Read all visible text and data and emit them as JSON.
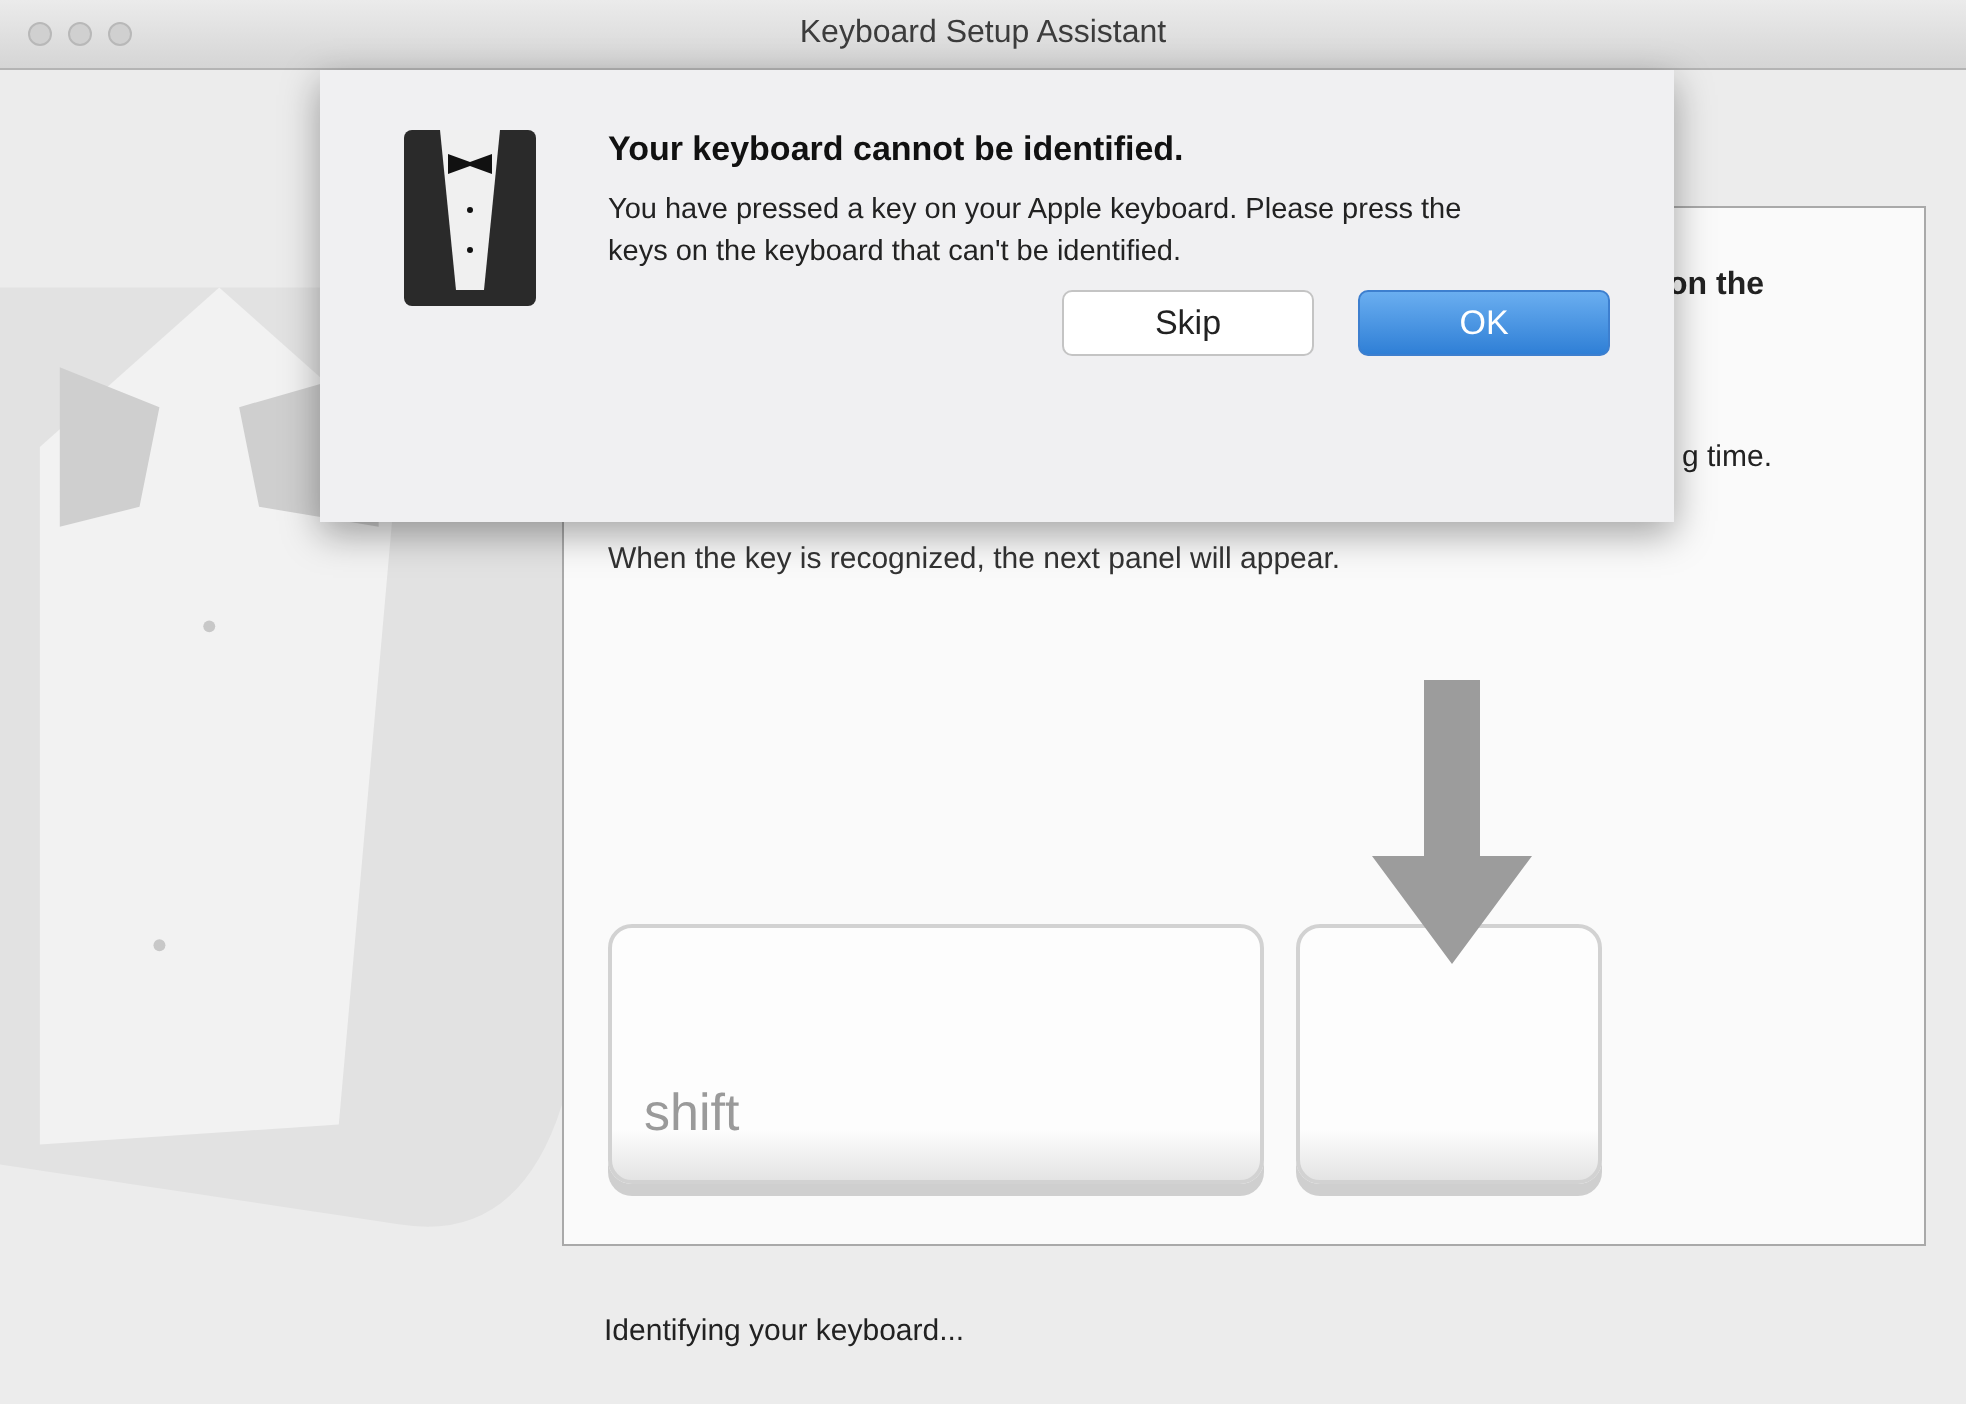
{
  "window": {
    "title": "Keyboard Setup Assistant"
  },
  "sheet": {
    "title": "Your keyboard cannot be identified.",
    "message": "You have pressed a key on your Apple keyboard. Please press the keys on the keyboard that can't be identified.",
    "buttons": [
      {
        "label": "Skip",
        "default": false
      },
      {
        "label": "OK",
        "default": true
      }
    ]
  },
  "panel": {
    "heading_fragment": "on the",
    "line_fragment": "g time.",
    "instruction": "When the key is recognized, the next panel will appear.",
    "key_label": "shift"
  },
  "status": "Identifying your keyboard..."
}
